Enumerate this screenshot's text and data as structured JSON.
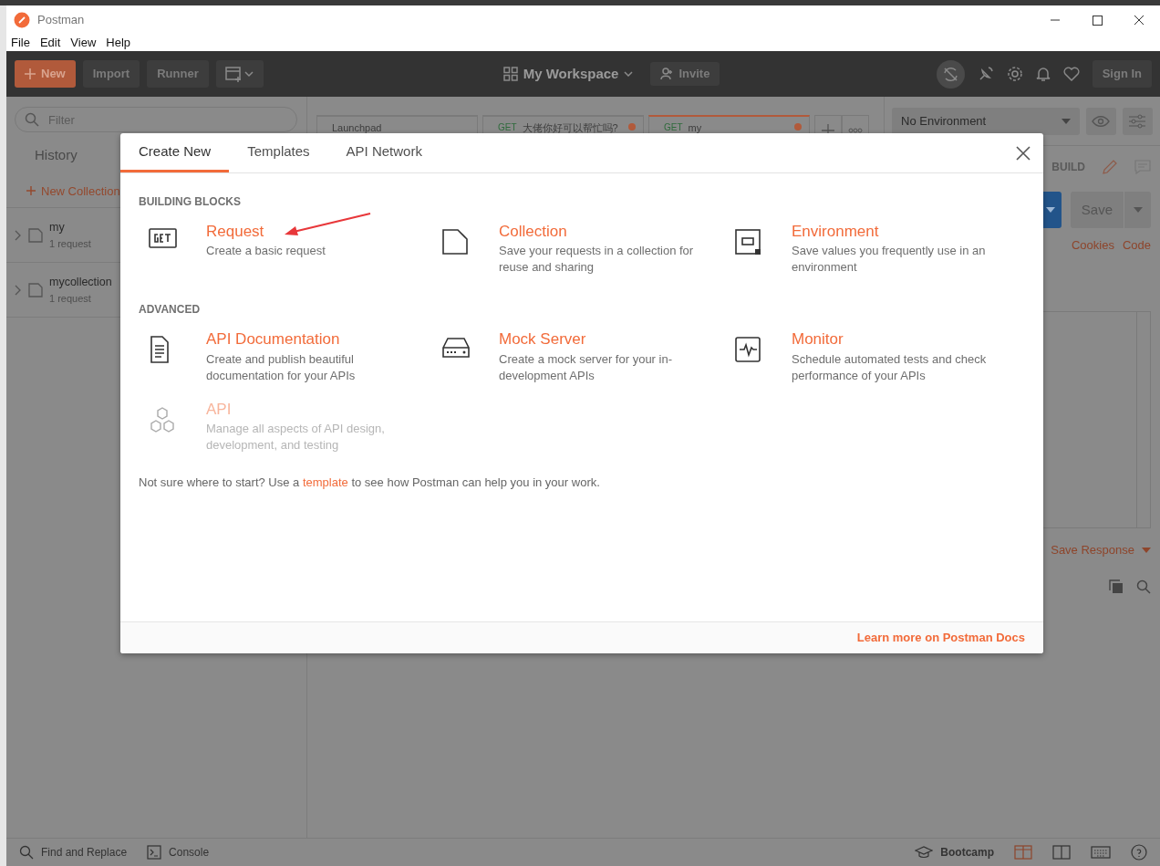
{
  "window": {
    "title": "Postman"
  },
  "menu": [
    "File",
    "Edit",
    "View",
    "Help"
  ],
  "header": {
    "new_button": "New",
    "buttons": [
      "Import",
      "Runner"
    ],
    "workspace": "My Workspace",
    "invite": "Invite",
    "sign_in": "Sign In"
  },
  "sidebar": {
    "filter_placeholder": "Filter",
    "tabs": [
      {
        "label": "History",
        "selected": false
      }
    ],
    "new_collection": "New Collection",
    "collections": [
      {
        "name": "my",
        "count": "1 request"
      },
      {
        "name": "mycollection",
        "count": "1 request"
      }
    ]
  },
  "request_tabs": [
    {
      "label": "Launchpad",
      "selected": false,
      "unsaved": false
    },
    {
      "method": "GET",
      "label": "大佬你好可以帮忙吗?",
      "selected": false,
      "unsaved": true
    },
    {
      "method": "GET",
      "label": "my",
      "selected": true,
      "unsaved": true
    }
  ],
  "environment": {
    "value": "No Environment"
  },
  "request": {
    "build": "BUILD",
    "save": "Save",
    "links": [
      "Cookies",
      "Code"
    ],
    "save_response": "Save Response"
  },
  "status_bar": {
    "left": [
      "Find and Replace",
      "Console"
    ],
    "bootcamp": "Bootcamp"
  },
  "modal": {
    "tabs": [
      {
        "label": "Create New",
        "selected": true
      },
      {
        "label": "Templates",
        "selected": false
      },
      {
        "label": "API Network",
        "selected": false
      }
    ],
    "sections": [
      {
        "title": "BUILDING BLOCKS",
        "items": [
          {
            "kind": "request",
            "title": "Request",
            "description": "Create a basic request",
            "disabled": false
          },
          {
            "kind": "collection",
            "title": "Collection",
            "description": "Save your requests in a collection for reuse and sharing",
            "disabled": false
          },
          {
            "kind": "environment",
            "title": "Environment",
            "description": "Save values you frequently use in an environment",
            "disabled": false
          }
        ]
      },
      {
        "title": "ADVANCED",
        "items": [
          {
            "kind": "documentation",
            "title": "API Documentation",
            "description": "Create and publish beautiful documentation for your APIs",
            "disabled": false
          },
          {
            "kind": "mock",
            "title": "Mock Server",
            "description": "Create a mock server for your in-development APIs",
            "disabled": false
          },
          {
            "kind": "monitor",
            "title": "Monitor",
            "description": "Schedule automated tests and check performance of your APIs",
            "disabled": false
          },
          {
            "kind": "api",
            "title": "API",
            "description": "Manage all aspects of API design, development, and testing",
            "disabled": true
          }
        ]
      }
    ],
    "note": {
      "before": "Not sure where to start? Use a",
      "link": "template",
      "after": "to see how Postman can help you in your work."
    },
    "footer_link": "Learn more on Postman Docs"
  }
}
